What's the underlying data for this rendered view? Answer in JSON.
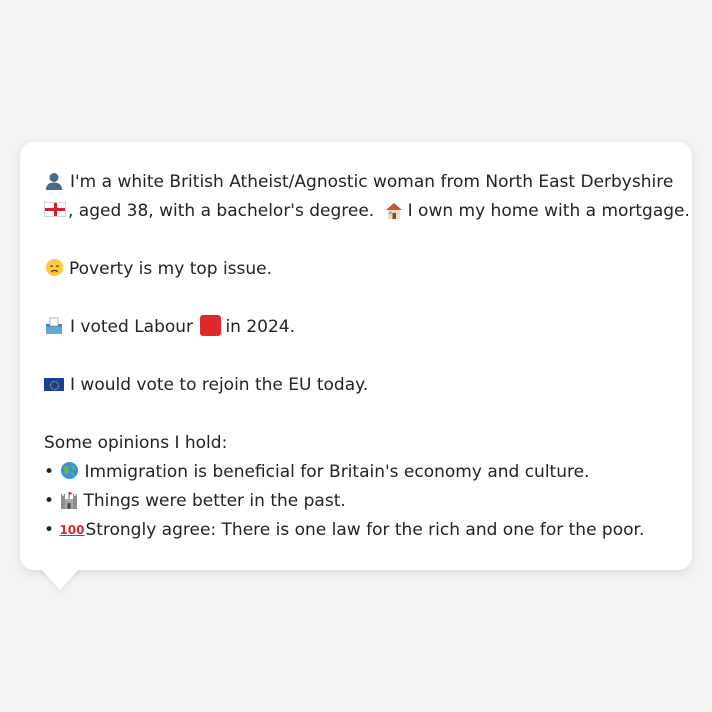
{
  "card": {
    "line1_text": "I'm a white British Atheist/Agnostic woman from North East Derbyshire",
    "line2_text_a": ", aged 38, with a bachelor's degree.",
    "line2_text_b": "I own my home with a mortgage.",
    "issue_text": "Poverty is my top issue.",
    "vote_text_a": "I voted Labour",
    "vote_text_b": "in 2024.",
    "eu_text": "I would vote to rejoin the EU today.",
    "opinions_heading": "Some opinions I hold:",
    "opinions": [
      {
        "bullet": "•",
        "text": "Immigration is beneficial for Britain's economy and culture."
      },
      {
        "bullet": "•",
        "text": "Things were better in the past."
      },
      {
        "bullet": "•",
        "text": "Strongly agree: There is one law for the rich and one for the poor."
      }
    ]
  },
  "icons": {
    "person": "bust-in-silhouette-icon",
    "england": "england-flag-icon",
    "home": "house-icon",
    "issue": "disappointed-face-icon",
    "ballot": "ballot-box-icon",
    "labour": "red-square-icon",
    "eu": "eu-flag-icon",
    "opinion1": "globe-icon",
    "opinion2": "castle-icon",
    "opinion3": "hundred-points-icon"
  },
  "colors": {
    "background": "#f1f3f5",
    "card": "#ffffff",
    "text": "#20232a",
    "labour_red": "#e0282e"
  }
}
